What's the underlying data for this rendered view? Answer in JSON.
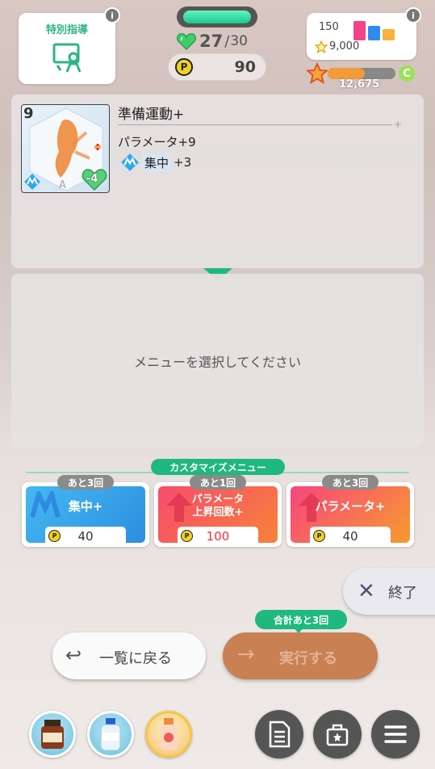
{
  "top": {
    "special_label": "特別指導",
    "info_glyph": "i",
    "hp": "27",
    "hp_slash": "/",
    "hp_max": "30",
    "stamina_fraction": 1.0,
    "p_glyph": "P",
    "p_points": "90",
    "stat_150": "150",
    "goal_value": "9,000",
    "rank_progress_fraction": 0.55,
    "rank_letter": "C",
    "rank_points": "12,675"
  },
  "card": {
    "level": "9",
    "cost": "-4",
    "grade": "A",
    "title": "準備運動+",
    "param_text": "パラメータ+9",
    "focus_label": "集中",
    "focus_value": "+3"
  },
  "menu_prompt": "メニューを選択してください",
  "custom": {
    "label": "カスタマイズメニュー",
    "options": [
      {
        "name": "集中+",
        "remain": "あと3回",
        "cost": "40",
        "color": "#2ea9ec"
      },
      {
        "name": "パラメータ\n上昇回数+",
        "remain": "あと1回",
        "cost": "100",
        "color": "#f43d6a"
      },
      {
        "name": "パラメータ+",
        "remain": "あと3回",
        "cost": "40",
        "color": "#f7457d"
      }
    ]
  },
  "buttons": {
    "end": "終了",
    "end_icon": "close-icon",
    "back": "一覧に戻る",
    "back_icon": "return-arrow-icon",
    "exec": "実行する",
    "exec_icon": "right-arrow-icon",
    "exec_badge": "合計あと3回"
  },
  "colors": {
    "accent": "#1fb87f",
    "exec": "#c98052",
    "focus_blue": "#2ea9ec"
  }
}
